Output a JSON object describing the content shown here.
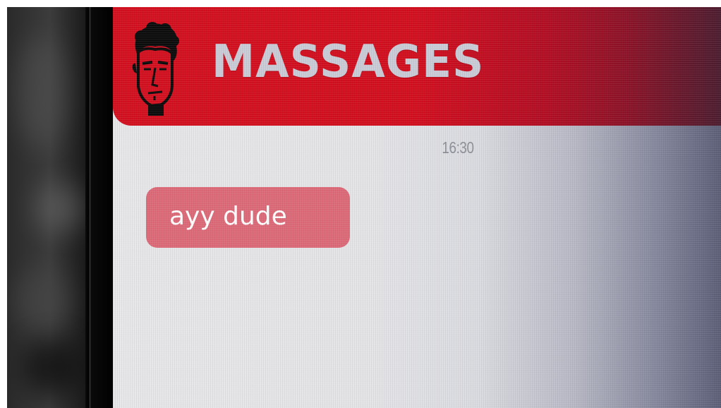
{
  "app": {
    "title": "MASSAGES",
    "avatar_icon": "man-face-icon"
  },
  "conversation": {
    "timestamp": "16:30",
    "messages": [
      {
        "text": "ayy dude",
        "direction": "incoming"
      }
    ]
  },
  "colors": {
    "header_red": "#d2101f",
    "title_text": "#c9cbd6",
    "bubble": "#dc6a78",
    "bubble_text": "#ffffff",
    "timestamp_text": "#8d8f99",
    "screen_bg": "#e7e7e9"
  }
}
